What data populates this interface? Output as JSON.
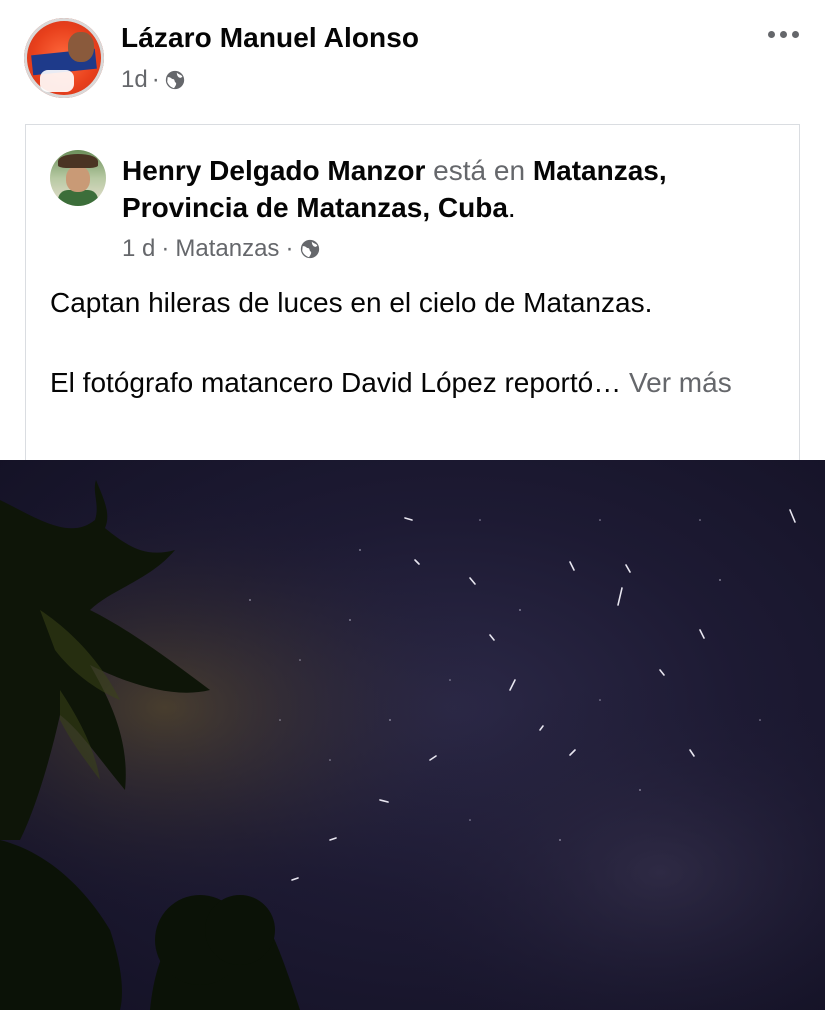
{
  "post": {
    "author": "Lázaro Manuel Alonso",
    "time": "1d",
    "privacy_icon": "globe-icon",
    "more_icon": "more-options-icon"
  },
  "shared": {
    "author": "Henry Delgado Manzor",
    "verb": "está en",
    "location_line1": "Matanzas,",
    "location_line2": "Provincia de Matanzas, Cuba",
    "period": ".",
    "time": "1 d",
    "place": "Matanzas",
    "privacy_icon": "globe-icon",
    "text_line1": "Captan hileras de luces en el cielo de Matanzas.",
    "text_line2": "El fotógrafo matancero David López reportó…",
    "see_more": "Ver más"
  },
  "photo": {
    "subject": "night-sky-with-light-trails-and-palm-trees",
    "sky_color": "#1d1a33",
    "foliage_color": "#0f1a0c"
  }
}
